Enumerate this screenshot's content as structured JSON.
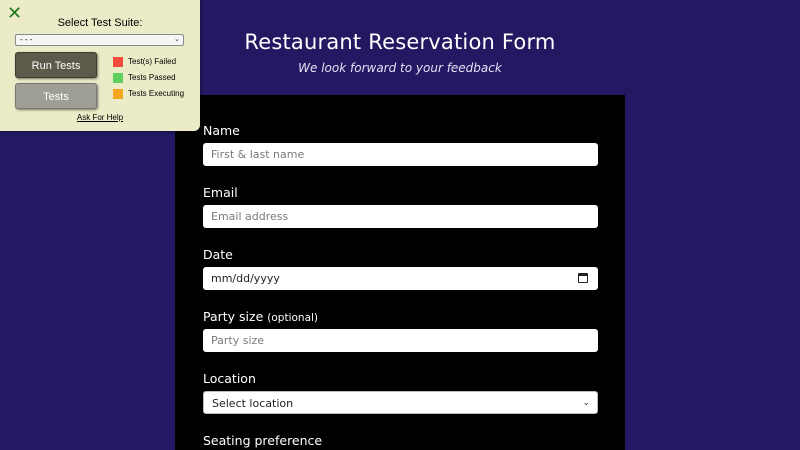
{
  "header": {
    "title": "Restaurant Reservation Form",
    "subtitle": "We look forward to your feedback"
  },
  "form": {
    "name": {
      "label": "Name",
      "placeholder": "First & last name"
    },
    "email": {
      "label": "Email",
      "placeholder": "Email address"
    },
    "date": {
      "label": "Date",
      "value": "mm/dd/yyyy"
    },
    "party_size": {
      "label": "Party size",
      "optional": "(optional)",
      "placeholder": "Party size"
    },
    "location": {
      "label": "Location",
      "selected": "Select location"
    },
    "seating": {
      "label": "Seating preference"
    }
  },
  "test_panel": {
    "title": "Select Test Suite:",
    "suite_selected": "- - -",
    "run_button": "Run Tests",
    "tests_button": "Tests",
    "legend": [
      {
        "label": "Test(s) Failed",
        "color": "#f24a3b"
      },
      {
        "label": "Tests Passed",
        "color": "#5cd15c"
      },
      {
        "label": "Tests Executing",
        "color": "#f5a520"
      }
    ],
    "help_link": "Ask For Help"
  },
  "colors": {
    "background": "#241863",
    "form_background": "#000000",
    "panel_background": "#ecebc8",
    "close_icon": "#1e7a1e"
  },
  "icons": {
    "close": "close-icon",
    "calendar": "calendar-icon",
    "dropdown": "chevron-down-icon"
  }
}
